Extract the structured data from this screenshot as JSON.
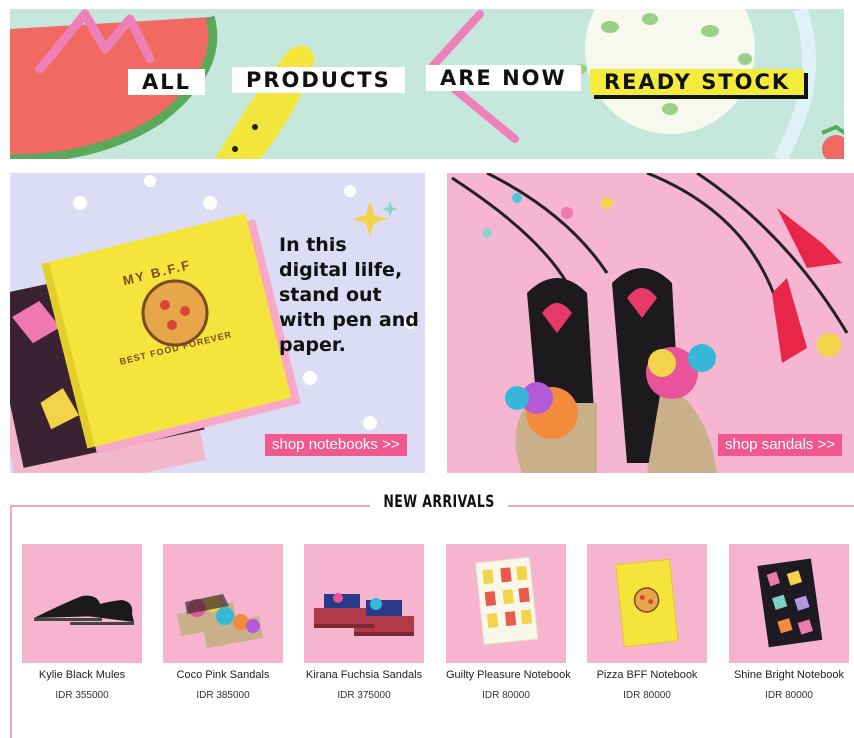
{
  "hero": {
    "words": [
      "ALL",
      "PRODUCTS",
      "ARE NOW",
      "READY STOCK"
    ]
  },
  "promos": {
    "notebooks": {
      "tagline": "In this digital lilfe, stand out with pen and paper.",
      "cover_text_top": "MY B.F.F",
      "cover_text_bottom": "BEST FOOD FOREVER",
      "button_label": "shop notebooks >>"
    },
    "sandals": {
      "button_label": "shop sandals >>"
    }
  },
  "new_arrivals": {
    "title": "NEW ARRIVALS",
    "products": [
      {
        "name": "Kylie Black Mules",
        "price": "IDR 355000",
        "thumb_icon": "black-mules-icon"
      },
      {
        "name": "Coco Pink Sandals",
        "price": "IDR 385000",
        "thumb_icon": "pink-sandals-icon"
      },
      {
        "name": "Kirana Fuchsia Sandals",
        "price": "IDR 375000",
        "thumb_icon": "fuchsia-sandals-icon"
      },
      {
        "name": "Guilty Pleasure Notebook",
        "price": "IDR 80000",
        "thumb_icon": "fries-notebook-icon"
      },
      {
        "name": "Pizza BFF Notebook",
        "price": "IDR 80000",
        "thumb_icon": "pizza-notebook-icon"
      },
      {
        "name": "Shine Bright Notebook",
        "price": "IDR 80000",
        "thumb_icon": "gem-notebook-icon"
      }
    ]
  },
  "colors": {
    "accent_pink": "#f1588d",
    "hero_mint": "#c6e8dc",
    "tile_pink": "#f6b4cf",
    "ready_yellow": "#f4ec3c"
  }
}
